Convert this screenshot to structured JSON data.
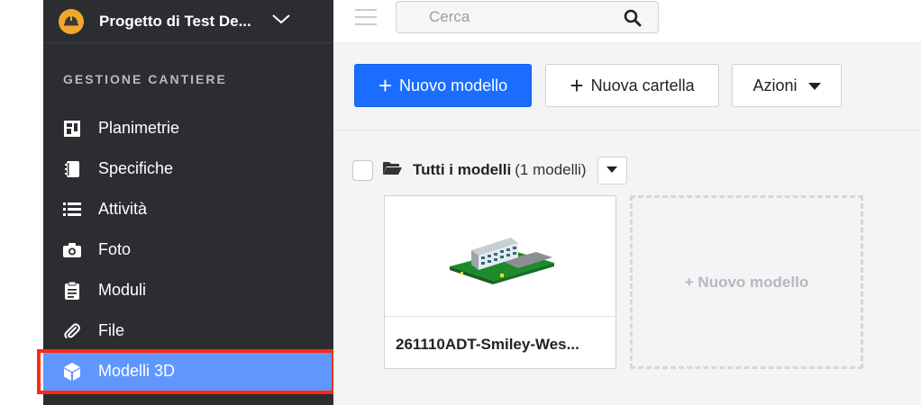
{
  "project": {
    "title": "Progetto di Test De...",
    "logo_icon": "hardhat-icon"
  },
  "sidebar": {
    "section_title": "GESTIONE CANTIERE",
    "items": [
      {
        "label": "Planimetrie",
        "icon": "floorplan-icon"
      },
      {
        "label": "Specifiche",
        "icon": "spec-book-icon"
      },
      {
        "label": "Attività",
        "icon": "task-list-icon"
      },
      {
        "label": "Foto",
        "icon": "camera-icon"
      },
      {
        "label": "Moduli",
        "icon": "clipboard-icon"
      },
      {
        "label": "File",
        "icon": "paperclip-icon"
      },
      {
        "label": "Modelli 3D",
        "icon": "cube-icon",
        "active": true
      }
    ],
    "highlight_color": "#ff2a0e",
    "active_color": "#5f97ff"
  },
  "search": {
    "placeholder": "Cerca"
  },
  "toolbar": {
    "new_model_label": "Nuovo modello",
    "new_folder_label": "Nuova cartella",
    "actions_label": "Azioni",
    "primary_color": "#1a6dff"
  },
  "folder": {
    "name": "Tutti i modelli",
    "count": "(1 modelli)"
  },
  "models": [
    {
      "name": "261110ADT-Smiley-Wes..."
    }
  ],
  "new_model_card": {
    "label": "+ Nuovo modello"
  }
}
